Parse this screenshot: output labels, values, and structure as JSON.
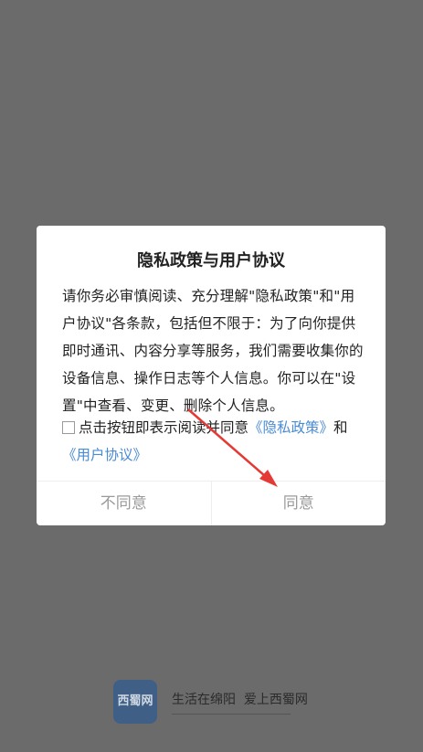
{
  "dialog": {
    "title": "隐私政策与用户协议",
    "body": "请你务必审慎阅读、充分理解\"隐私政策\"和\"用户协议\"各条款，包括但不限于：为了向你提供即时通讯、内容分享等服务，我们需要收集你的设备信息、操作日志等个人信息。你可以在\"设置\"中查看、变更、删除个人信息。",
    "consent_prefix": "点击按钮即表示阅读并同意",
    "privacy_link": "《隐私政策》",
    "and_text": "和",
    "user_agreement_link": "《用户协议》",
    "disagree_label": "不同意",
    "agree_label": "同意"
  },
  "footer": {
    "logo_text": "西蜀网",
    "slogan": "生活在绵阳  爱上西蜀网"
  },
  "colors": {
    "overlay": "#6b6b6b",
    "link": "#4a8bd6",
    "button_text": "#9a9a9a",
    "arrow": "#e53935",
    "logo_bg": "#3f5f86"
  }
}
